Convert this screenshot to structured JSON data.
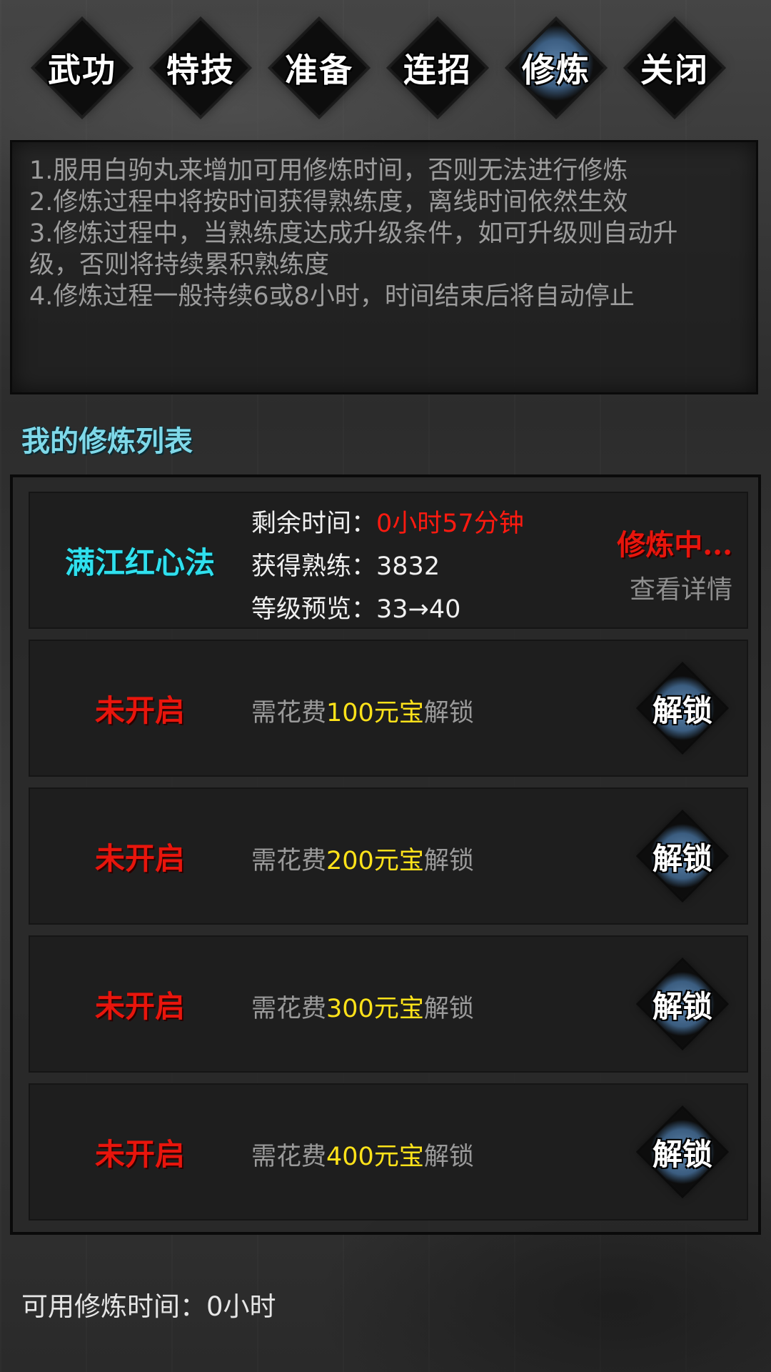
{
  "tabs": [
    {
      "label": "武功",
      "active": false
    },
    {
      "label": "特技",
      "active": false
    },
    {
      "label": "准备",
      "active": false
    },
    {
      "label": "连招",
      "active": false
    },
    {
      "label": "修炼",
      "active": true
    },
    {
      "label": "关闭",
      "active": false
    }
  ],
  "info": {
    "lines": [
      "1.服用白驹丸来增加可用修炼时间，否则无法进行修炼",
      "2.修炼过程中将按时间获得熟练度，离线时间依然生效",
      "3.修炼过程中，当熟练度达成升级条件，如可升级则自动升",
      "级，否则将持续累积熟练度",
      "4.修炼过程一般持续6或8小时，时间结束后将自动停止"
    ]
  },
  "section_title": "我的修炼列表",
  "active_slot": {
    "name": "满江红心法",
    "remaining_label": "剩余时间：",
    "remaining_value": "0小时57分钟",
    "exp_label": "获得熟练：",
    "exp_value": "3832",
    "level_label": "等级预览：",
    "level_value": "33→40",
    "status": "修炼中...",
    "detail_link": "查看详情"
  },
  "locked_slots": [
    {
      "name": "未开启",
      "prefix": "需花费",
      "amount": "100元宝",
      "suffix": "解锁",
      "button": "解锁"
    },
    {
      "name": "未开启",
      "prefix": "需花费",
      "amount": "200元宝",
      "suffix": "解锁",
      "button": "解锁"
    },
    {
      "name": "未开启",
      "prefix": "需花费",
      "amount": "300元宝",
      "suffix": "解锁",
      "button": "解锁"
    },
    {
      "name": "未开启",
      "prefix": "需花费",
      "amount": "400元宝",
      "suffix": "解锁",
      "button": "解锁"
    }
  ],
  "footer": {
    "text": "可用修炼时间：0小时"
  },
  "colors": {
    "accent_blue": "#3c5e82",
    "active_name": "#2fe0ee",
    "locked_red": "#e8150c",
    "gold": "#ffe21a"
  }
}
